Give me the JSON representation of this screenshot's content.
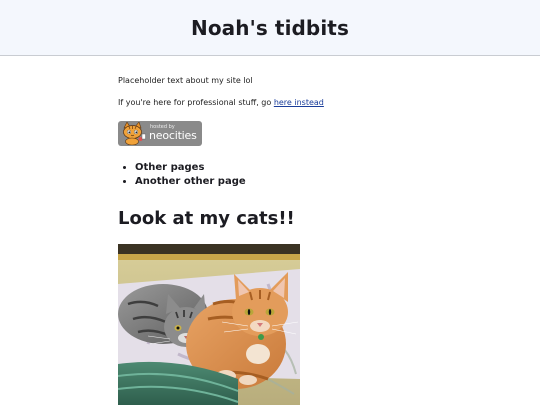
{
  "header": {
    "title": "Noah's tidbits"
  },
  "main": {
    "intro_text": "Placeholder text about my site lol",
    "professional_prefix": "If you're here for professional stuff, go ",
    "professional_link": "here instead",
    "badge": {
      "hosted_by": "hosted by",
      "brand": "neocities",
      "mascot_icon": "neocities-cat-icon"
    },
    "nav_items": [
      {
        "label": "Other pages"
      },
      {
        "label": "Another other page"
      }
    ],
    "cats_heading": "Look at my cats!!",
    "cats_photo": {
      "subject": "two cats: a grey tabby and an orange tabby"
    }
  },
  "colors": {
    "header_bg": "#f4f7fd",
    "link": "#1a3d9a",
    "badge_bg": "#8a8a8a",
    "text": "#1c1c22"
  }
}
